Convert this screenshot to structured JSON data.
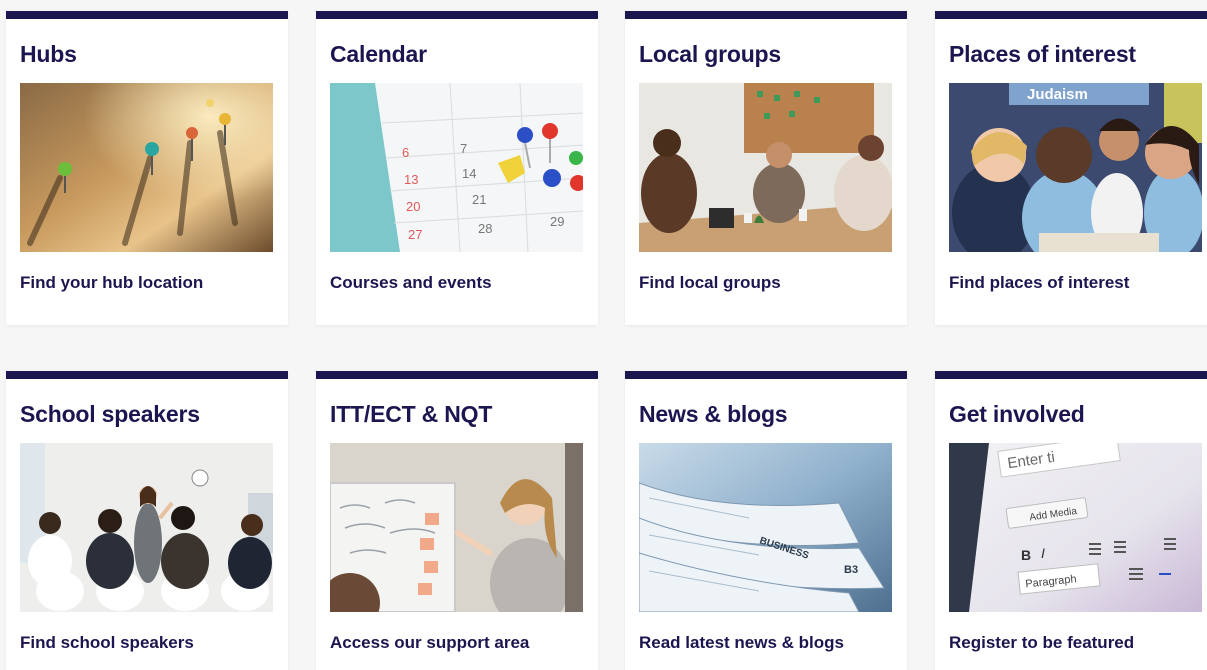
{
  "colors": {
    "accent": "#1c1650",
    "card_bg": "#ffffff",
    "page_bg": "#f6f6f7"
  },
  "cards": [
    {
      "title": "Hubs",
      "link": "Find your hub location",
      "image": "map-pins-photo"
    },
    {
      "title": "Calendar",
      "link": "Courses and events",
      "image": "calendar-pins-photo"
    },
    {
      "title": "Local groups",
      "link": "Find local groups",
      "image": "group-meeting-photo"
    },
    {
      "title": "Places of interest",
      "link": "Find places of interest",
      "image": "children-learning-photo"
    },
    {
      "title": "School speakers",
      "link": "Find school speakers",
      "image": "speaker-presentation-photo"
    },
    {
      "title": "ITT/ECT & NQT",
      "link": "Access our support area",
      "image": "teacher-whiteboard-photo"
    },
    {
      "title": "News & blogs",
      "link": "Read latest news & blogs",
      "image": "newspapers-photo"
    },
    {
      "title": "Get involved",
      "link": "Register to be featured",
      "image": "editor-screen-photo"
    }
  ],
  "calendar_image": {
    "dates": [
      "6",
      "7",
      "13",
      "14",
      "20",
      "21",
      "27",
      "28",
      "29"
    ]
  },
  "places_image": {
    "sign_text": "Judaism"
  },
  "news_image": {
    "headline": "BUSINESS",
    "page_number": "B3"
  },
  "editor_image": {
    "input_placeholder": "Enter ti",
    "add_media": "Add Media",
    "paragraph": "Paragraph",
    "toolbar_bold": "B",
    "toolbar_italic": "I"
  }
}
